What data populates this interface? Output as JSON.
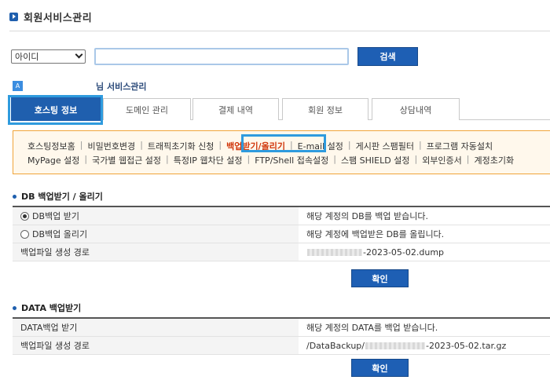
{
  "header": {
    "title": "회원서비스관리"
  },
  "search": {
    "select_value": "아이디",
    "input_value": "",
    "button_label": "검색"
  },
  "account": {
    "badge": "A",
    "name_suffix": "님 서비스관리"
  },
  "tabs": [
    {
      "label": "호스팅 정보",
      "active": true
    },
    {
      "label": "도메인 관리"
    },
    {
      "label": "결제 내역"
    },
    {
      "label": "회원 정보"
    },
    {
      "label": "상담내역"
    }
  ],
  "submenu": {
    "row1": [
      "호스팅정보홈",
      "비밀번호변경",
      "트래픽초기화 신청",
      "백업받기/올리기",
      "E-mail 설정",
      "게시판 스팸필터",
      "프로그램 자동설치"
    ],
    "row2": [
      "MyPage 설정",
      "국가별 웹접근 설정",
      "특정IP 웹차단 설정",
      "FTP/Shell 접속설정",
      "스팸 SHIELD 설정",
      "외부인증서",
      "계정초기화"
    ],
    "active": "백업받기/올리기"
  },
  "db_section": {
    "title": "DB 백업받기 / 올리기",
    "rows": [
      {
        "label": "DB백업 받기",
        "value": "해당 계정의 DB를 백업 받습니다."
      },
      {
        "label": "DB백업 올리기",
        "value": "해당 계정에 백업받은 DB를 올립니다."
      },
      {
        "label": "백업파일 생성 경로",
        "value_suffix": "-2023-05-02.dump"
      }
    ],
    "button_label": "확인"
  },
  "data_section": {
    "title": "DATA 백업받기",
    "rows": [
      {
        "label": "DATA백업 받기",
        "value": "해당 계정의 DATA를 백업 받습니다."
      },
      {
        "label": "백업파일 생성 경로",
        "value_prefix": "/DataBackup/",
        "value_suffix": "-2023-05-02.tar.gz"
      }
    ],
    "button_label": "확인"
  },
  "colors": {
    "primary": "#1f5fae",
    "highlight": "#2f9bde",
    "submenu_border": "#f0a43a",
    "active_menu": "#d0360a"
  }
}
